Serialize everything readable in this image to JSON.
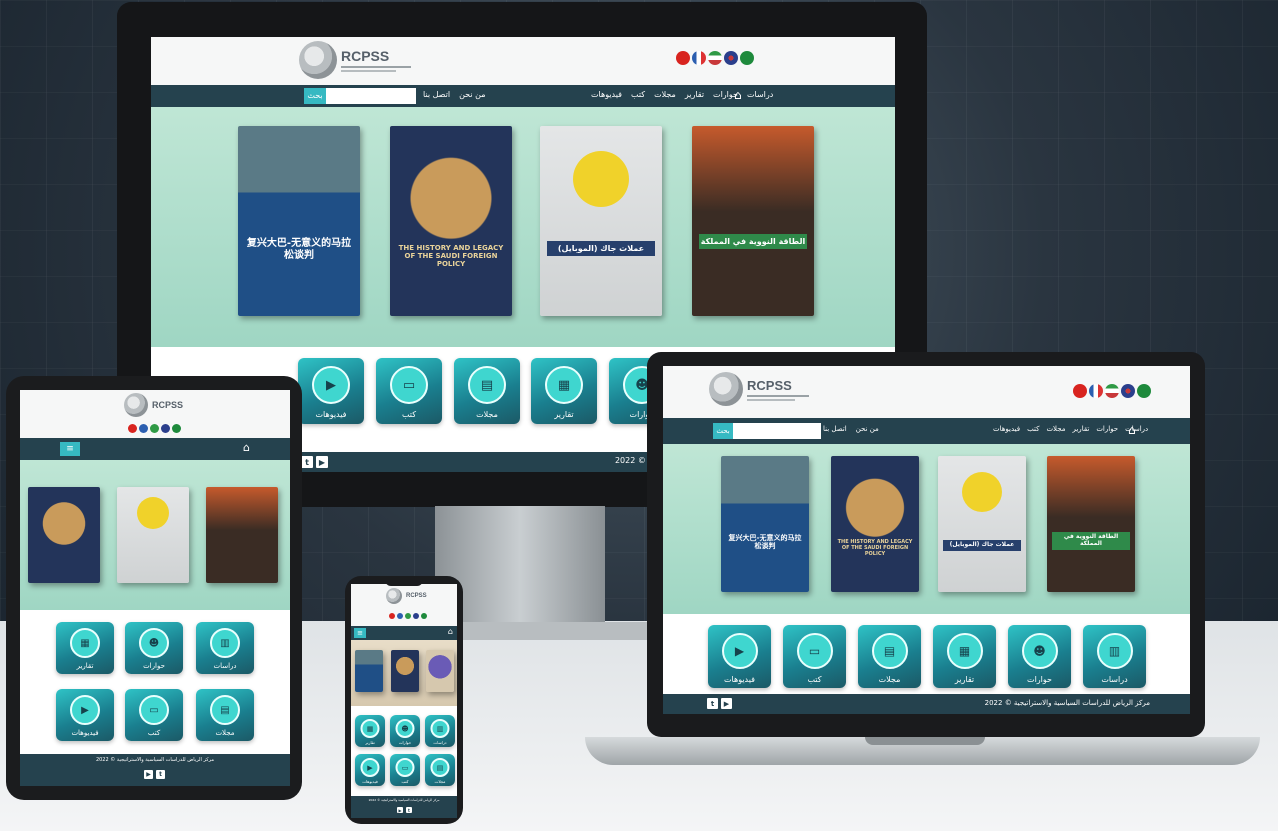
{
  "brand": {
    "logo_text": "RCPSS"
  },
  "colors": {
    "primary": "#25424e",
    "accent": "#2fc3c6",
    "hero": "#a6d9c6"
  },
  "flags": [
    {
      "name": "saudi-flag",
      "color": "#1e8a3c"
    },
    {
      "name": "uk-flag",
      "color": "#2b3f8c"
    },
    {
      "name": "iran-flag",
      "color": "#c8383a"
    },
    {
      "name": "france-flag",
      "color": "#2c5fb0"
    },
    {
      "name": "china-flag",
      "color": "#d8241f"
    }
  ],
  "nav": {
    "items": [
      "دراسات",
      "حوارات",
      "تقارير",
      "مجلات",
      "كتب",
      "فيديوهات"
    ],
    "links": [
      "من نحن",
      "اتصل بنا"
    ],
    "search_button": "بحث",
    "search_placeholder": ""
  },
  "books": [
    {
      "title": "复兴大巴-无意义的马拉松谈判",
      "color": "#1f4f86"
    },
    {
      "title": "THE HISTORY AND LEGACY OF THE SAUDI FOREIGN POLICY",
      "color": "#23345a"
    },
    {
      "title": "عملات جاك (الموبايل)",
      "color": "#d8dadb"
    },
    {
      "title": "الطاقة النووية في المملكة",
      "color": "#3a2c24"
    }
  ],
  "tiles": [
    {
      "label": "فيديوهات",
      "icon": "video-icon",
      "glyph": "▶"
    },
    {
      "label": "كتب",
      "icon": "book-icon",
      "glyph": "▭"
    },
    {
      "label": "مجلات",
      "icon": "magazine-icon",
      "glyph": "▤"
    },
    {
      "label": "تقارير",
      "icon": "report-icon",
      "glyph": "▦"
    },
    {
      "label": "حوارات",
      "icon": "dialogue-icon",
      "glyph": "☻"
    },
    {
      "label": "دراسات",
      "icon": "study-icon",
      "glyph": "▥"
    }
  ],
  "footer": {
    "copyright": "مركز الرياض للدراسات السياسية والاستراتيجية © 2022",
    "copyright_short": "2022 © ...البحية"
  },
  "social": [
    "twitter-icon",
    "youtube-icon"
  ]
}
